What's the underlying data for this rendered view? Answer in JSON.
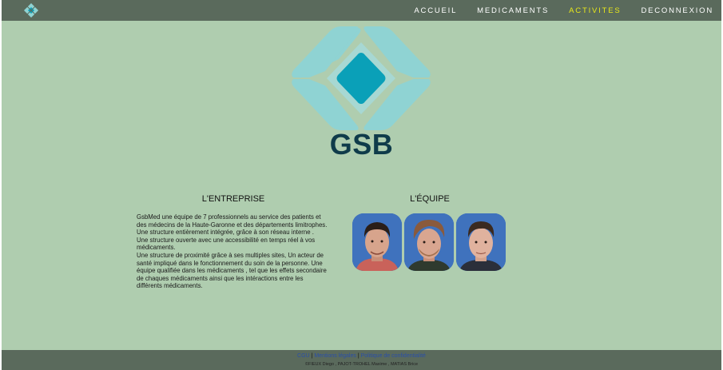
{
  "nav": {
    "items": [
      {
        "label": "ACCUEIL",
        "active": false
      },
      {
        "label": "MEDICAMENTS",
        "active": false
      },
      {
        "label": "ACTIVITES",
        "active": true
      },
      {
        "label": "DECONNEXION",
        "active": false
      }
    ]
  },
  "hero": {
    "brand": "GSB"
  },
  "company": {
    "title": "L'ENTREPRISE",
    "paragraphs": [
      "GsbMed une équipe de 7 professionnels au service des patients et des médecins de la Haute-Garonne et des départements limitrophes.",
      "Une structure entièrement intégrée, grâce à son réseau interne .",
      "Une structure ouverte avec une accessibilité en temps réel à vos médicaments.",
      "Une structure de proximité grâce à ses multiples sites, Un acteur de santé impliqué dans le fonctionnement du soin de la personne. Une équipe qualifiée dans les médicaments , tel que les effets secondaire de chaques médicaments ainsi que les intéractions entre les différents médicaments."
    ]
  },
  "team": {
    "title": "L'ÉQUIPE",
    "members": [
      {
        "icon": "person-photo"
      },
      {
        "icon": "person-photo"
      },
      {
        "icon": "person-photo"
      }
    ]
  },
  "footer": {
    "links": [
      "CGU",
      "Mentions légales",
      "Politique de confidentialité"
    ],
    "separator": "|",
    "credit": "©FIEUX Diego , PAJOT-TROHEL Maxime , MATIAS Brice"
  },
  "colors": {
    "background": "#afcdaf",
    "nav_bg": "#5a6a5c",
    "active_link": "#e8e81a",
    "brand_text": "#0f3b4a",
    "logo_light": "#8fd3d3",
    "logo_center": "#0aa0b8"
  }
}
